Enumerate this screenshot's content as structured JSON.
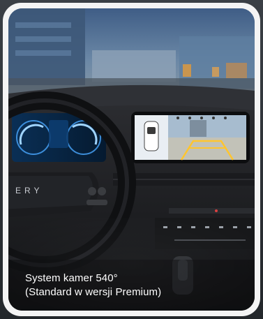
{
  "caption": {
    "line1": "System kamer 540°",
    "line2": "(Standard w wersji Premium)"
  },
  "steering_wheel_brand": "ERY",
  "colors": {
    "card_frame": "#f4f4f4",
    "cluster_blue": "#4aa7ff",
    "screen_guideline": "#ffc52e",
    "background": "#2b2f34"
  }
}
